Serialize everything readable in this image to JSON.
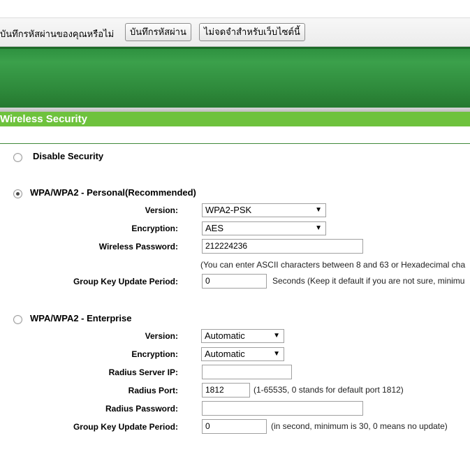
{
  "save_password_bar": {
    "prompt": "บันทึกรหัสผ่านของคุณหรือไม่",
    "save_button": "บันทึกรหัสผ่าน",
    "never_button": "ไม่จดจำสำหรับเว็บไซต์นี้"
  },
  "page": {
    "title": "Wireless Security"
  },
  "disable": {
    "label": "Disable Security",
    "selected": false
  },
  "personal": {
    "label": "WPA/WPA2 - Personal(Recommended)",
    "selected": true,
    "version_label": "Version:",
    "version_value": "WPA2-PSK",
    "encryption_label": "Encryption:",
    "encryption_value": "AES",
    "password_label": "Wireless Password:",
    "password_value": "212224236",
    "password_note": "(You can enter ASCII characters between 8 and 63 or Hexadecimal cha",
    "gkup_label": "Group Key Update Period:",
    "gkup_value": "0",
    "gkup_note": "Seconds (Keep it default if you are not sure, minimu"
  },
  "enterprise": {
    "label": "WPA/WPA2 - Enterprise",
    "selected": false,
    "version_label": "Version:",
    "version_value": "Automatic",
    "encryption_label": "Encryption:",
    "encryption_value": "Automatic",
    "radius_ip_label": "Radius Server IP:",
    "radius_ip_value": "",
    "radius_port_label": "Radius Port:",
    "radius_port_value": "1812",
    "radius_port_note": "(1-65535, 0 stands for default port 1812)",
    "radius_password_label": "Radius Password:",
    "radius_password_value": "",
    "gkup_label": "Group Key Update Period:",
    "gkup_value": "0",
    "gkup_note": "(in second, minimum is 30, 0 means no update)"
  },
  "icons": {
    "dropdown": "chevron-down-icon"
  },
  "colors": {
    "header_green": "#2e8a3b",
    "title_green": "#6ec23d"
  }
}
